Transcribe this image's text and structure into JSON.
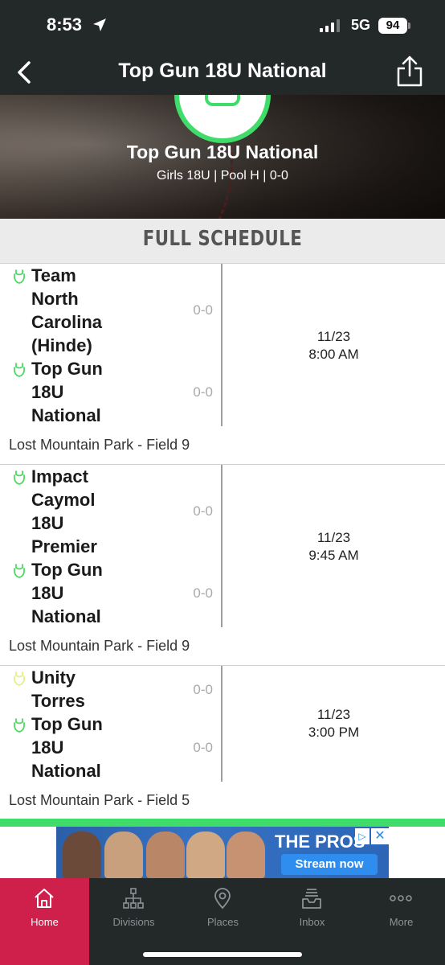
{
  "status_bar": {
    "time": "8:53",
    "network": "5G",
    "battery": "94"
  },
  "nav": {
    "title": "Top Gun 18U National",
    "back_icon": "chevron-left-icon",
    "share_icon": "share-icon"
  },
  "hero": {
    "team_name": "Top Gun 18U National",
    "subtitle": "Girls 18U | Pool H | 0-0"
  },
  "section": {
    "title": "FULL SCHEDULE"
  },
  "games": [
    {
      "teams": [
        {
          "name": "Team North Carolina (Hinde)",
          "score": "0-0",
          "icon_color": "#4cd964"
        },
        {
          "name": "Top Gun 18U National",
          "score": "0-0",
          "icon_color": "#4cd964"
        }
      ],
      "date": "11/23",
      "time": "8:00 AM",
      "venue": "Lost Mountain Park - Field 9"
    },
    {
      "teams": [
        {
          "name": "Impact Caymol 18U Premier",
          "score": "0-0",
          "icon_color": "#4cd964"
        },
        {
          "name": "Top Gun 18U National",
          "score": "0-0",
          "icon_color": "#4cd964"
        }
      ],
      "date": "11/23",
      "time": "9:45 AM",
      "venue": "Lost Mountain Park - Field 9"
    },
    {
      "teams": [
        {
          "name": "Unity Torres",
          "score": "0-0",
          "icon_color": "#e6ef8a"
        },
        {
          "name": "Top Gun 18U National",
          "score": "0-0",
          "icon_color": "#4cd964"
        }
      ],
      "date": "11/23",
      "time": "3:00 PM",
      "venue": "Lost Mountain Park - Field 5"
    }
  ],
  "ad": {
    "brand": "THE PROS",
    "cta": "Stream now",
    "close": "✕",
    "choices": "▷"
  },
  "tabs": [
    {
      "label": "Home",
      "icon": "home-icon",
      "active": true
    },
    {
      "label": "Divisions",
      "icon": "divisions-icon",
      "active": false
    },
    {
      "label": "Places",
      "icon": "places-icon",
      "active": false
    },
    {
      "label": "Inbox",
      "icon": "inbox-icon",
      "active": false
    },
    {
      "label": "More",
      "icon": "more-icon",
      "active": false
    }
  ],
  "colors": {
    "accent_green": "#3fdc6a",
    "active_tab": "#cf1f4b",
    "bar_dark": "#232829"
  }
}
